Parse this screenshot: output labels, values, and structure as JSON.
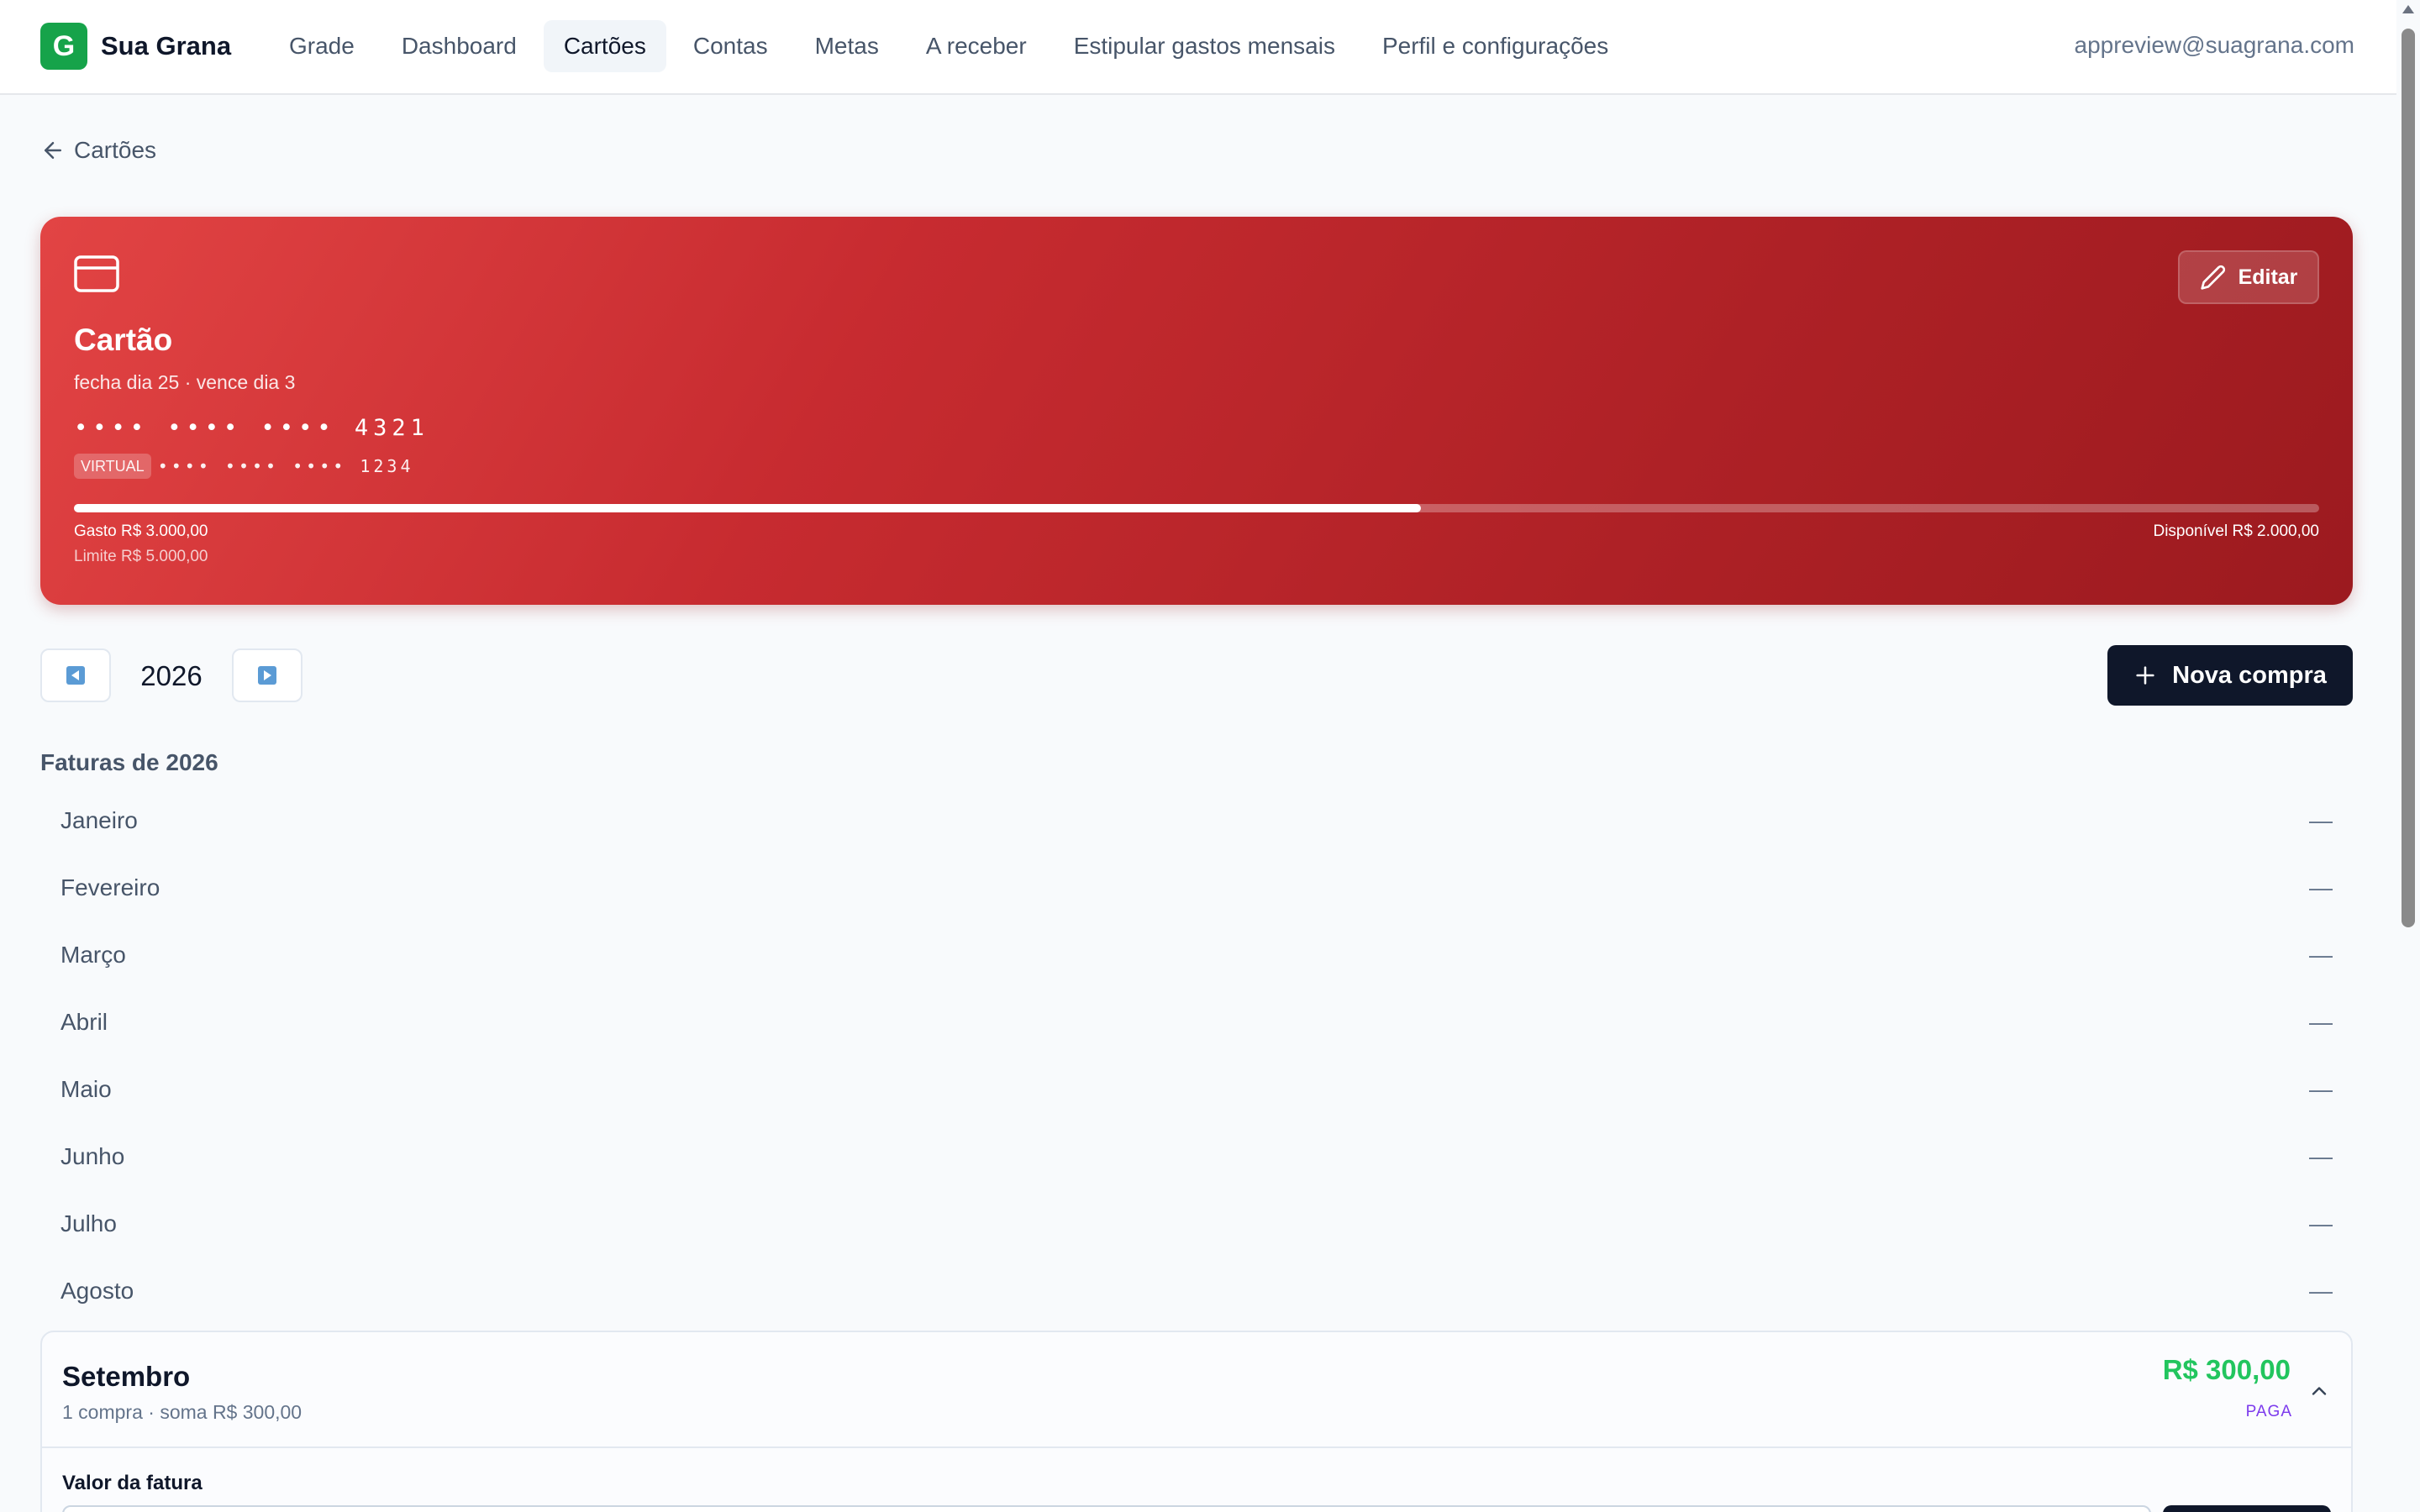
{
  "app": {
    "brand_letter": "G",
    "brand_name": "Sua Grana",
    "user_email": "appreview@suagrana.com",
    "accent_color": "#16a34a"
  },
  "nav": {
    "items": [
      {
        "label": "Grade",
        "active": false
      },
      {
        "label": "Dashboard",
        "active": false
      },
      {
        "label": "Cartões",
        "active": true
      },
      {
        "label": "Contas",
        "active": false
      },
      {
        "label": "Metas",
        "active": false
      },
      {
        "label": "A receber",
        "active": false
      },
      {
        "label": "Estipular gastos mensais",
        "active": false
      },
      {
        "label": "Perfil e configurações",
        "active": false
      }
    ]
  },
  "breadcrumb": {
    "back_label": "Cartões",
    "icon": "arrow-left-icon"
  },
  "card": {
    "name": "Cartão",
    "cycle": "fecha dia 25 · vence dia 3",
    "number": "•••• •••• •••• 4321",
    "virtual_badge": "VIRTUAL",
    "virtual_number": "•••• •••• •••• 1234",
    "edit_label": "Editar",
    "spent_label": "Gasto R$ 3.000,00",
    "limit_label": "Limite R$ 5.000,00",
    "available_label": "Disponível R$ 2.000,00",
    "usage_fraction": 0.6,
    "color": "#c72b30",
    "icon": "credit-card-icon"
  },
  "year_selector": {
    "year": "2026",
    "prev_icon": "arrow-left-box-icon",
    "next_icon": "arrow-right-box-icon"
  },
  "actions": {
    "new_purchase_label": "Nova compra",
    "icon": "plus-icon"
  },
  "invoices": {
    "title": "Faturas de 2026",
    "months": [
      {
        "name": "Janeiro",
        "value": "—"
      },
      {
        "name": "Fevereiro",
        "value": "—"
      },
      {
        "name": "Março",
        "value": "—"
      },
      {
        "name": "Abril",
        "value": "—"
      },
      {
        "name": "Maio",
        "value": "—"
      },
      {
        "name": "Junho",
        "value": "—"
      },
      {
        "name": "Julho",
        "value": "—"
      },
      {
        "name": "Agosto",
        "value": "—"
      }
    ],
    "expanded": {
      "name": "Setembro",
      "summary": "1 compra · soma R$ 300,00",
      "amount": "R$ 300,00",
      "status": "PAGA",
      "field_label": "Valor da fatura",
      "amount_color": "#22c55e",
      "status_color": "#7c3aed"
    }
  }
}
